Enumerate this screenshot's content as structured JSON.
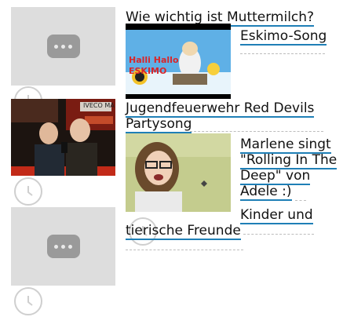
{
  "items": [
    {
      "title": "Wie wichtig ist Muttermilch?"
    },
    {
      "title": "Eskimo-Song",
      "thumb_text": "Halli Hallo ESKIMO"
    },
    {
      "title": "Jugendfeuerwehr Red Devils Partysong",
      "thumb_text": "IVECO MAGIRUS"
    },
    {
      "title": "Marlene singt \"Rolling In The Deep\" von Adele :)"
    },
    {
      "title": "Kinder und tierische Freunde"
    }
  ],
  "colors": {
    "link_underline": "#1f7fb6",
    "placeholder_bg": "#dddddd",
    "dots_bg": "#9a9a9a"
  },
  "icons": [
    "more-dots-icon",
    "clock-icon"
  ]
}
